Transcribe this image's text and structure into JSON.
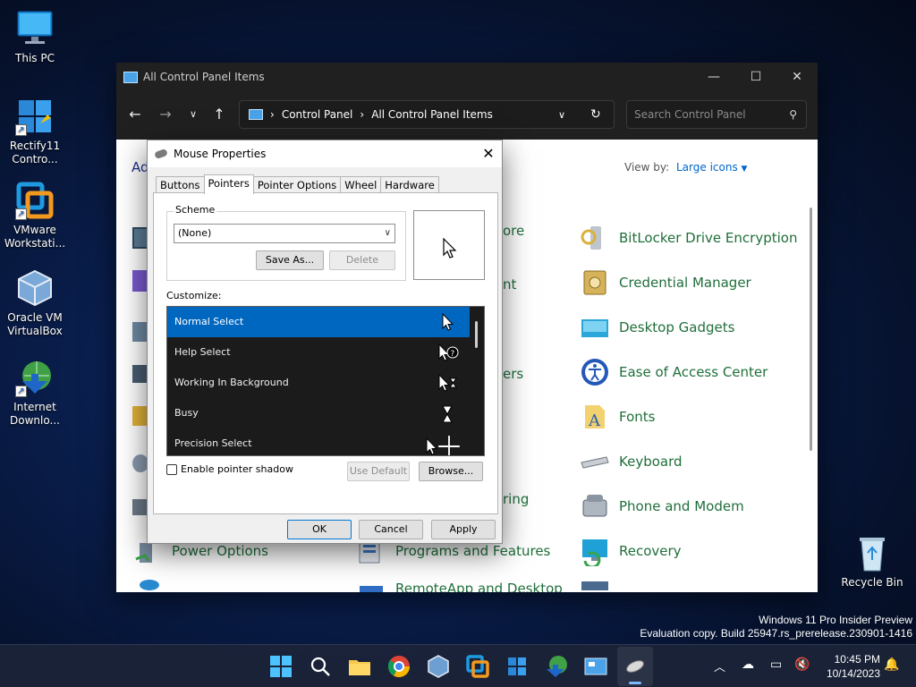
{
  "desktop": {
    "icons": [
      {
        "label": "This PC"
      },
      {
        "label": "Rectify11 Contro..."
      },
      {
        "label": "VMware Workstati..."
      },
      {
        "label": "Oracle VM VirtualBox"
      },
      {
        "label": "Internet Downlo..."
      }
    ],
    "recycle_bin": "Recycle Bin"
  },
  "control_panel": {
    "title": "All Control Panel Items",
    "breadcrumb": [
      "Control Panel",
      "All Control Panel Items"
    ],
    "search_placeholder": "Search Control Panel",
    "left_partial": "Ad",
    "view_by_label": "View by:",
    "view_by_value": "Large icons",
    "items_right": [
      "BitLocker Drive Encryption",
      "Credential Manager",
      "Desktop Gadgets",
      "Ease of Access Center",
      "Fonts",
      "Keyboard",
      "Phone and Modem",
      "Recovery"
    ],
    "items_mid_partial": [
      "ore",
      "nt",
      "ers",
      "ring"
    ],
    "items_bottom": [
      "Power Options",
      "Programs and Features",
      "RemoteApp and Desktop"
    ]
  },
  "dialog": {
    "title": "Mouse Properties",
    "tabs": [
      "Buttons",
      "Pointers",
      "Pointer Options",
      "Wheel",
      "Hardware"
    ],
    "active_tab": "Pointers",
    "scheme_label": "Scheme",
    "scheme_value": "(None)",
    "save_as": "Save As...",
    "delete": "Delete",
    "customize_label": "Customize:",
    "list": [
      "Normal Select",
      "Help Select",
      "Working In Background",
      "Busy",
      "Precision Select"
    ],
    "selected": "Normal Select",
    "enable_shadow": "Enable pointer shadow",
    "use_default": "Use Default",
    "browse": "Browse...",
    "ok": "OK",
    "cancel": "Cancel",
    "apply": "Apply"
  },
  "watermark": {
    "line1": "Windows 11 Pro Insider Preview",
    "line2": "Evaluation copy. Build 25947.rs_prerelease.230901-1416"
  },
  "clock": {
    "time": "10:45 PM",
    "date": "10/14/2023"
  },
  "colors": {
    "accent": "#0067c0",
    "link_green": "#1f6f3a"
  }
}
